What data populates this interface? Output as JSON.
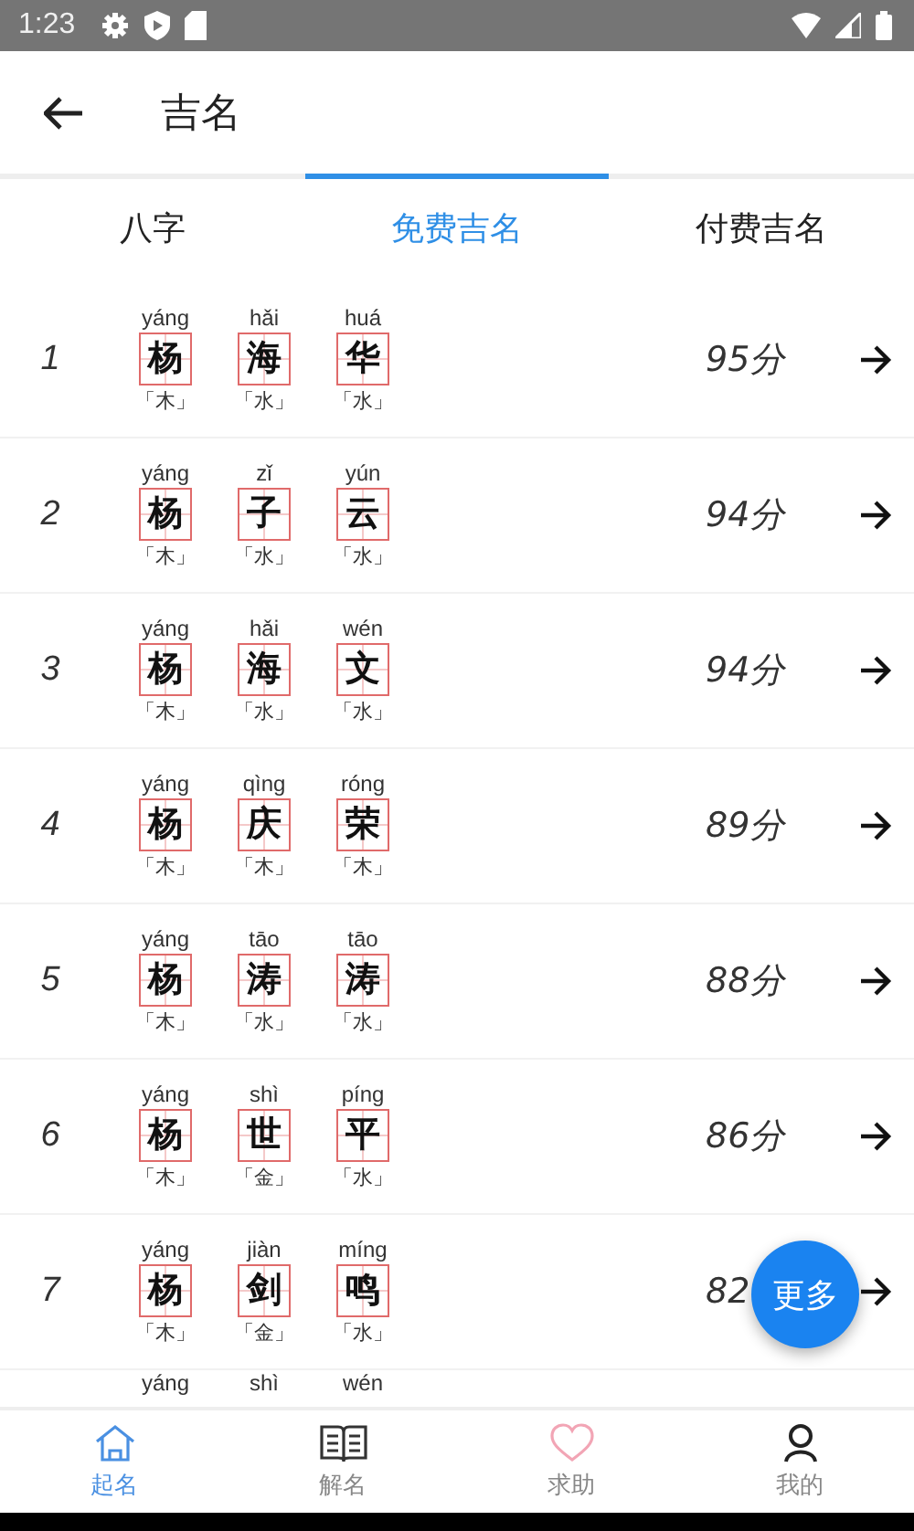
{
  "status_bar": {
    "time": "1:23"
  },
  "app_bar": {
    "title": "吉名"
  },
  "tabs": [
    {
      "label": "八字",
      "selected": false
    },
    {
      "label": "免费吉名",
      "selected": true
    },
    {
      "label": "付费吉名",
      "selected": false
    }
  ],
  "names": [
    {
      "rank": "1",
      "chars": [
        {
          "pinyin": "yáng",
          "char": "杨",
          "element": "「木」"
        },
        {
          "pinyin": "hǎi",
          "char": "海",
          "element": "「水」"
        },
        {
          "pinyin": "huá",
          "char": "华",
          "element": "「水」"
        }
      ],
      "score": "95分"
    },
    {
      "rank": "2",
      "chars": [
        {
          "pinyin": "yáng",
          "char": "杨",
          "element": "「木」"
        },
        {
          "pinyin": "zǐ",
          "char": "子",
          "element": "「水」"
        },
        {
          "pinyin": "yún",
          "char": "云",
          "element": "「水」"
        }
      ],
      "score": "94分"
    },
    {
      "rank": "3",
      "chars": [
        {
          "pinyin": "yáng",
          "char": "杨",
          "element": "「木」"
        },
        {
          "pinyin": "hǎi",
          "char": "海",
          "element": "「水」"
        },
        {
          "pinyin": "wén",
          "char": "文",
          "element": "「水」"
        }
      ],
      "score": "94分"
    },
    {
      "rank": "4",
      "chars": [
        {
          "pinyin": "yáng",
          "char": "杨",
          "element": "「木」"
        },
        {
          "pinyin": "qìng",
          "char": "庆",
          "element": "「木」"
        },
        {
          "pinyin": "róng",
          "char": "荣",
          "element": "「木」"
        }
      ],
      "score": "89分"
    },
    {
      "rank": "5",
      "chars": [
        {
          "pinyin": "yáng",
          "char": "杨",
          "element": "「木」"
        },
        {
          "pinyin": "tāo",
          "char": "涛",
          "element": "「水」"
        },
        {
          "pinyin": "tāo",
          "char": "涛",
          "element": "「水」"
        }
      ],
      "score": "88分"
    },
    {
      "rank": "6",
      "chars": [
        {
          "pinyin": "yáng",
          "char": "杨",
          "element": "「木」"
        },
        {
          "pinyin": "shì",
          "char": "世",
          "element": "「金」"
        },
        {
          "pinyin": "píng",
          "char": "平",
          "element": "「水」"
        }
      ],
      "score": "86分"
    },
    {
      "rank": "7",
      "chars": [
        {
          "pinyin": "yáng",
          "char": "杨",
          "element": "「木」"
        },
        {
          "pinyin": "jiàn",
          "char": "剑",
          "element": "「金」"
        },
        {
          "pinyin": "míng",
          "char": "鸣",
          "element": "「水」"
        }
      ],
      "score": "82"
    }
  ],
  "cut_row": {
    "pinyin": [
      "yáng",
      "shì",
      "wén"
    ]
  },
  "fab": {
    "label": "更多"
  },
  "bottom_nav": [
    {
      "label": "起名",
      "selected": true
    },
    {
      "label": "解名",
      "selected": false
    },
    {
      "label": "求助",
      "selected": false
    },
    {
      "label": "我的",
      "selected": false
    }
  ]
}
